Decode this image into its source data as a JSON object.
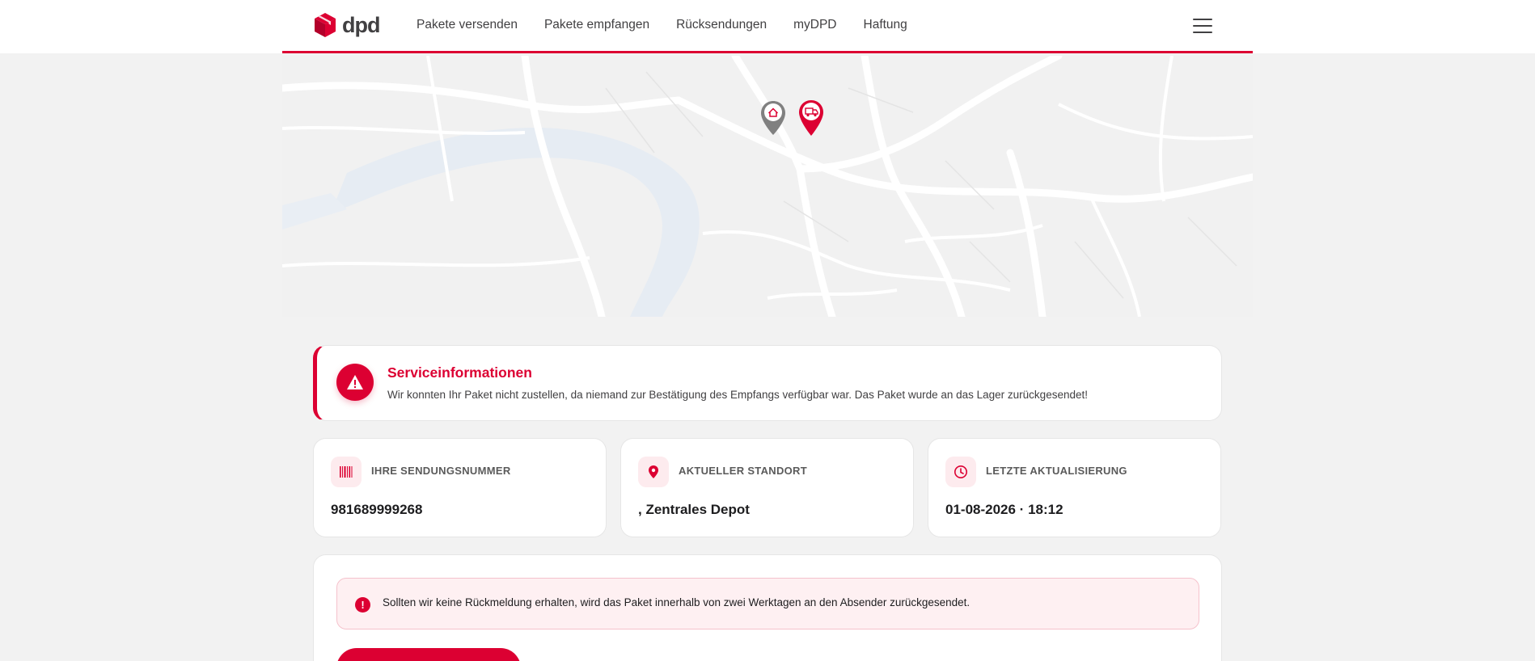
{
  "header": {
    "logo_text": "dpd",
    "nav": [
      "Pakete versenden",
      "Pakete empfangen",
      "Rücksendungen",
      "myDPD",
      "Haftung"
    ],
    "menu_icon": "hamburger-menu-icon"
  },
  "map": {
    "markers": [
      "home-pin-icon",
      "delivery-van-pin-icon"
    ]
  },
  "service": {
    "icon": "warning-triangle-icon",
    "title": "Serviceinformationen",
    "text": "Wir konnten Ihr Paket nicht zustellen, da niemand zur Bestätigung des Empfangs verfügbar war. Das Paket wurde an das Lager zurückgesendet!"
  },
  "cards": [
    {
      "icon": "barcode-icon",
      "label": "IHRE SENDUNGSNUMMER",
      "value": "981689999268"
    },
    {
      "icon": "location-pin-icon",
      "label": "AKTUELLER STANDORT",
      "value": ", Zentrales Depot"
    },
    {
      "icon": "clock-icon",
      "label": "LETZTE AKTUALISIERUNG",
      "value": "01-08-2026 · 18:12"
    }
  ],
  "notice": {
    "icon": "exclamation-icon",
    "text": "Sollten wir keine Rückmeldung erhalten, wird das Paket innerhalb von zwei Werktagen an den Absender zurückgesendet."
  },
  "colors": {
    "brand_red": "#dc0032",
    "text_dark": "#414042",
    "background": "#f2f2f2"
  }
}
